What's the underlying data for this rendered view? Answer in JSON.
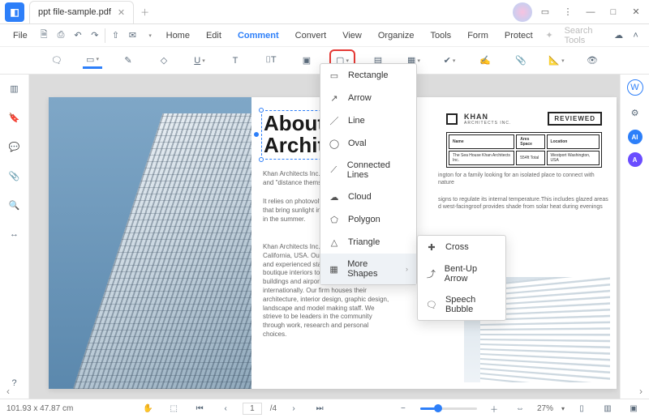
{
  "title": "ppt file-sample.pdf",
  "menubar": {
    "file": "File",
    "home": "Home",
    "edit": "Edit",
    "comment": "Comment",
    "convert": "Convert",
    "view": "View",
    "organize": "Organize",
    "tools": "Tools",
    "form": "Form",
    "protect": "Protect",
    "search": "Search Tools"
  },
  "shapes_menu": {
    "rectangle": "Rectangle",
    "arrow": "Arrow",
    "line": "Line",
    "oval": "Oval",
    "connected": "Connected Lines",
    "cloud": "Cloud",
    "polygon": "Polygon",
    "triangle": "Triangle",
    "more": "More Shapes"
  },
  "more_shapes_menu": {
    "cross": "Cross",
    "bentup": "Bent-Up Arrow",
    "speech": "Speech Bubble"
  },
  "doc": {
    "heading_l1": "About ",
    "heading_l2": "Archite",
    "para1": "Khan Architects Inc., created",
    "para1b": "and \"distance themselves fr",
    "para2": "It relies on photovoltaic pane",
    "para2b": "that bring sunlight in to warm",
    "para2c": "in the summer.",
    "para3": "Khan Architects Inc., is a mid firm based in California, USA. Our exceptionally talented and experienced staff work on projects from boutique interiors to large institutional buildings and airport complexes, locally and internationally. Our firm houses their architecture, interior design, graphic design, landscape and model making staff. We strieve to be leaders in the community through work, research and personal choices.",
    "right1": "ington for a family looking for an isolated place to connect with nature",
    "right2": "signs to regulate its internal temperature.This includes glazed areas d west-facingroof provides shade from solar heat during evenings",
    "brand": "KHAN",
    "brand_sub": "ARCHITECTS INC.",
    "reviewed": "REVIEWED",
    "table": {
      "h1": "Name",
      "h2": "Ares Space",
      "h3": "Location",
      "v1": "The Sea House Khan Architects Inc.",
      "v2": "554ft Total",
      "v3": "Westport Washington, USA"
    }
  },
  "status": {
    "coords": "101.93 x 47.87 cm",
    "page_current": "1",
    "page_total": "/4",
    "zoom": "27%"
  }
}
